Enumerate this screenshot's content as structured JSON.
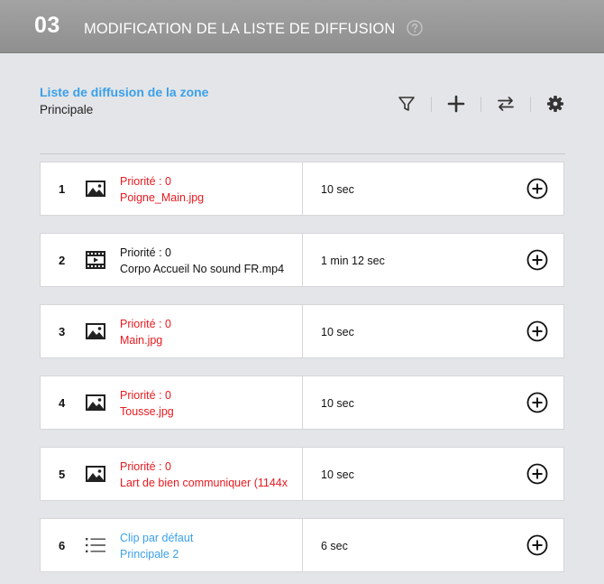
{
  "header": {
    "step": "03",
    "title": "MODIFICATION DE LA LISTE DE DIFFUSION"
  },
  "zone": {
    "label": "Liste de diffusion de la zone",
    "name": "Principale"
  },
  "toolbar": {
    "icons": [
      "filter-icon",
      "plus-icon",
      "swap-icon",
      "gear-icon"
    ]
  },
  "colors": {
    "accent_blue": "#3aa0ea",
    "error_red": "#e8191f",
    "header_gray": "#9a9a9a",
    "background": "#e4e5e8"
  },
  "items": [
    {
      "index": "1",
      "type": "image",
      "icon": "image-icon",
      "line1": "Priorité : 0",
      "line2": "Poigne_Main.jpg",
      "duration": "10 sec",
      "status": "red"
    },
    {
      "index": "2",
      "type": "video",
      "icon": "video-icon",
      "line1": "Priorité : 0",
      "line2": "Corpo Accueil No sound FR.mp4",
      "duration": "1 min 12 sec",
      "status": "dark"
    },
    {
      "index": "3",
      "type": "image",
      "icon": "image-icon",
      "line1": "Priorité : 0",
      "line2": "Main.jpg",
      "duration": "10 sec",
      "status": "red"
    },
    {
      "index": "4",
      "type": "image",
      "icon": "image-icon",
      "line1": "Priorité : 0",
      "line2": "Tousse.jpg",
      "duration": "10 sec",
      "status": "red"
    },
    {
      "index": "5",
      "type": "image",
      "icon": "image-icon",
      "line1": "Priorité : 0",
      "line2": "Lart de bien communiquer (1144x",
      "duration": "10 sec",
      "status": "red"
    },
    {
      "index": "6",
      "type": "list",
      "icon": "list-icon",
      "line1": "Clip par défaut",
      "line2": "Principale 2",
      "duration": "6 sec",
      "status": "blue"
    }
  ]
}
